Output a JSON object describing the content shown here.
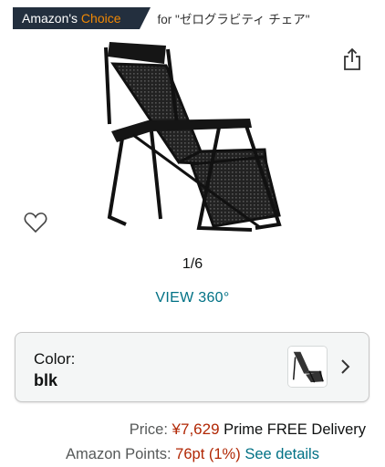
{
  "badge": {
    "prefix": "Amazon's ",
    "highlight": "Choice",
    "for_text": "for \"ゼログラビティ チェア\""
  },
  "gallery": {
    "counter": "1/6",
    "view360_label": "VIEW 360°"
  },
  "color_selector": {
    "label": "Color:",
    "value": "blk"
  },
  "price": {
    "label": "Price:",
    "value": "¥7,629",
    "delivery": "Prime FREE Delivery"
  },
  "points": {
    "label": "Amazon Points:",
    "value": "76pt",
    "percent": "(1%)",
    "details_link": "See details"
  },
  "colors": {
    "badge_bg": "#232f3e",
    "choice_orange": "#f08804",
    "price_red": "#b12704",
    "link_teal": "#007185"
  }
}
